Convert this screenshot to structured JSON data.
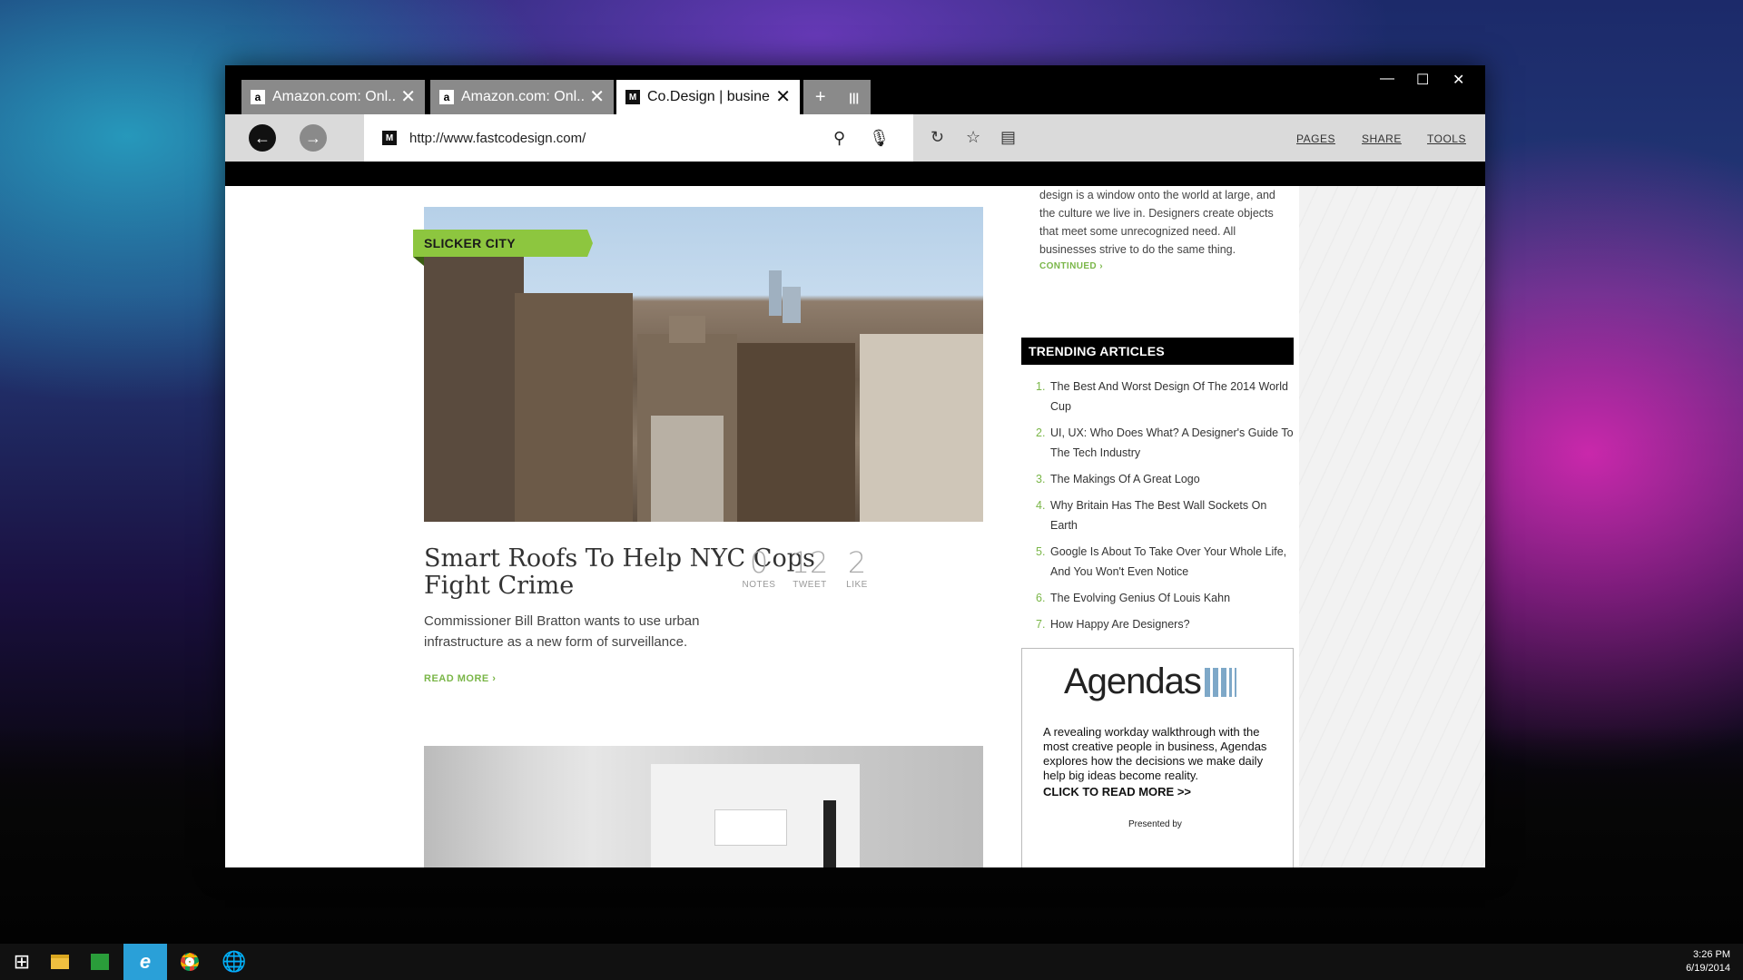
{
  "tabs": [
    {
      "title": "Amazon.com: Onl...",
      "favicon": "a"
    },
    {
      "title": "Amazon.com: Onl...",
      "favicon": "a"
    },
    {
      "title": "Co.Design | busines...",
      "favicon": "M"
    }
  ],
  "tab_controls": {
    "new_tab": "+",
    "tab_list": "|||"
  },
  "window_controls": {
    "minimize": "—",
    "maximize": "☐",
    "close": "✕"
  },
  "navbar": {
    "url": "http://www.fastcodesign.com/",
    "favicon": "M",
    "links": [
      "PAGES",
      "SHARE",
      "TOOLS"
    ]
  },
  "article": {
    "category": "SLICKER CITY",
    "title": "Smart Roofs To Help NYC Cops Fight Crime",
    "description": "Commissioner Bill Bratton wants to use urban infrastructure as a new form of surveillance.",
    "read_more": "READ MORE  ›",
    "stats": [
      {
        "value": "0",
        "label": "NOTES"
      },
      {
        "value": "12",
        "label": "TWEET"
      },
      {
        "value": "2",
        "label": "LIKE"
      }
    ]
  },
  "sidebar": {
    "intro": "design is a window onto the world at large, and the culture we live in. Designers create objects that meet some unrecognized need. All businesses strive to do the same thing.",
    "continued": "CONTINUED  ›",
    "trending_title": "TRENDING ARTICLES",
    "trending": [
      {
        "n": "1.",
        "title": "The Best And Worst Design Of The 2014 World Cup"
      },
      {
        "n": "2.",
        "title": "UI, UX: Who Does What? A Designer's Guide To The Tech Industry"
      },
      {
        "n": "3.",
        "title": "The Makings Of A Great Logo"
      },
      {
        "n": "4.",
        "title": "Why Britain Has The Best Wall Sockets On Earth"
      },
      {
        "n": "5.",
        "title": "Google Is About To Take Over Your Whole Life, And You Won't Even Notice"
      },
      {
        "n": "6.",
        "title": "The Evolving Genius Of Louis Kahn"
      },
      {
        "n": "7.",
        "title": "How Happy Are Designers?"
      }
    ]
  },
  "ad": {
    "logo": "Agendas",
    "text": "A revealing workday walkthrough with the most creative people in business, Agendas explores how the decisions we make daily help big ideas become reality.",
    "cta": "CLICK TO READ MORE >>",
    "presented_by": "Presented by"
  },
  "taskbar": {
    "icons": [
      "windows-start-icon",
      "file-explorer-icon",
      "store-icon",
      "internet-explorer-icon",
      "chrome-icon",
      "globe-icon"
    ],
    "time": "3:26 PM",
    "date": "6/19/2014"
  },
  "colors": {
    "accent_green": "#8dc63f",
    "link_green": "#7ab648",
    "taskbar_active": "#2aa0d8"
  }
}
